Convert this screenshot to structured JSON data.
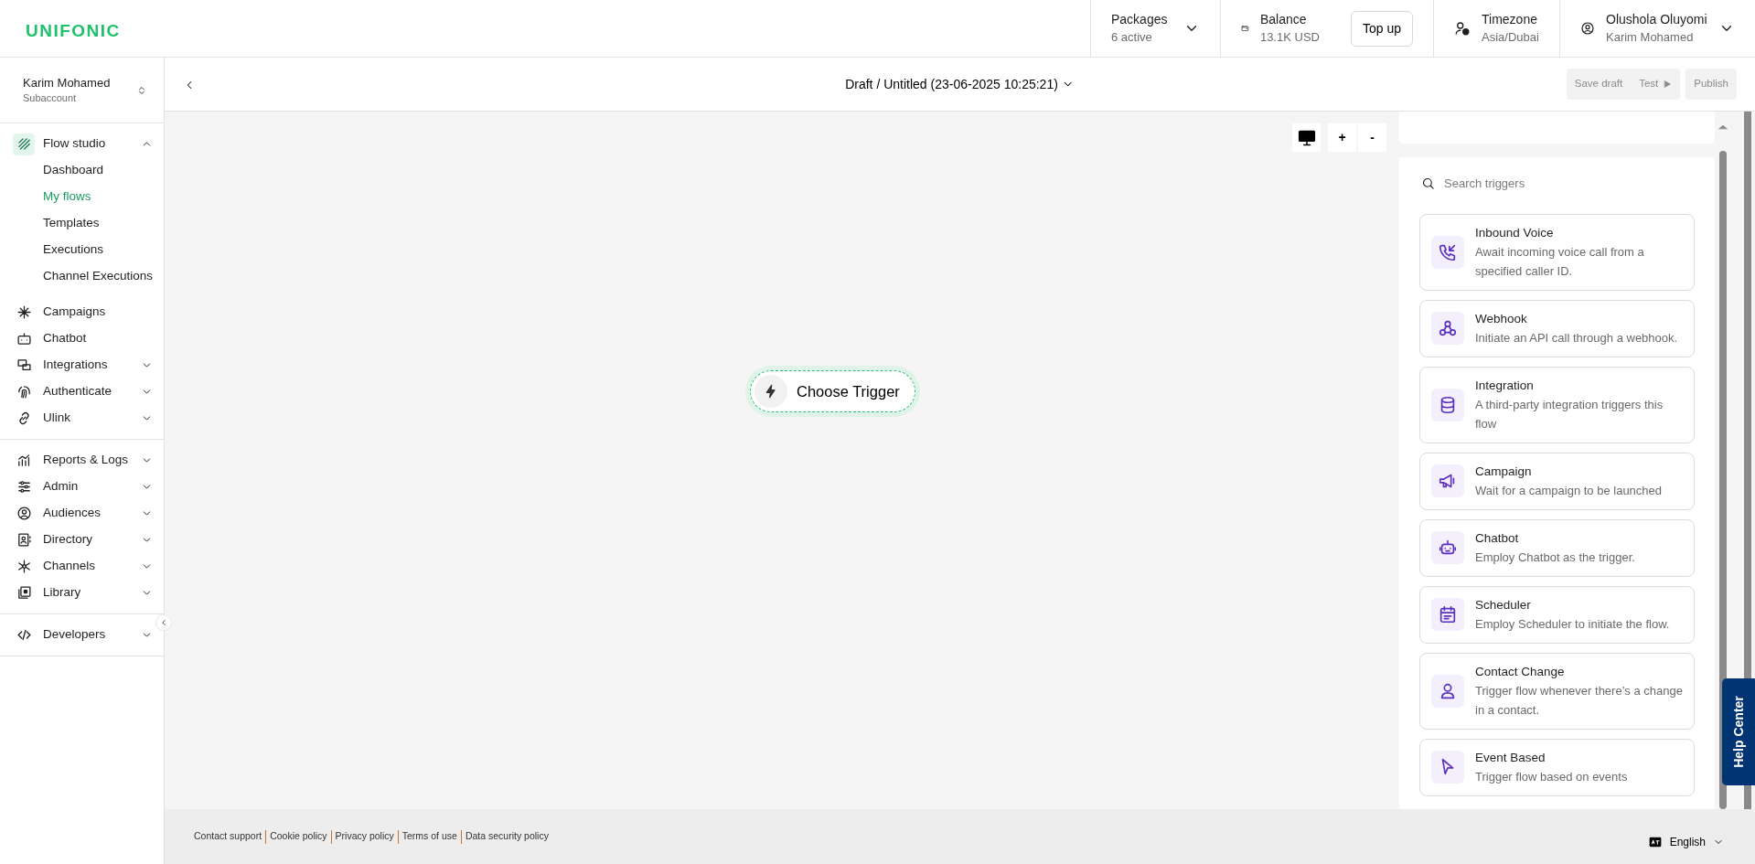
{
  "brand": "UNIFONIC",
  "header": {
    "packages": {
      "label": "Packages",
      "value": "6 active"
    },
    "balance": {
      "label": "Balance",
      "value": "13.1K USD",
      "button": "Top up"
    },
    "timezone": {
      "label": "Timezone",
      "value": "Asia/Dubai"
    },
    "user": {
      "name": "Olushola Oluyomi",
      "account": "Karim Mohamed"
    }
  },
  "account": {
    "name": "Karim Mohamed",
    "type": "Subaccount"
  },
  "sidebar": {
    "groups": [
      [
        {
          "label": "Flow studio",
          "selected": true,
          "expanded": true,
          "children": [
            {
              "label": "Dashboard",
              "selected": false
            },
            {
              "label": "My flows",
              "selected": true
            },
            {
              "label": "Templates",
              "selected": false
            },
            {
              "label": "Executions",
              "selected": false
            },
            {
              "label": "Channel Executions",
              "selected": false
            }
          ]
        },
        {
          "label": "Campaigns",
          "selected": false
        },
        {
          "label": "Chatbot",
          "selected": false
        },
        {
          "label": "Integrations",
          "selected": false,
          "expanded": false
        },
        {
          "label": "Authenticate",
          "selected": false,
          "expanded": false
        },
        {
          "label": "Ulink",
          "selected": false,
          "expanded": false
        }
      ],
      [
        {
          "label": "Reports & Logs",
          "selected": false,
          "expanded": false
        },
        {
          "label": "Admin",
          "selected": false,
          "expanded": false
        },
        {
          "label": "Audiences",
          "selected": false,
          "expanded": false
        },
        {
          "label": "Directory",
          "selected": false,
          "expanded": false
        },
        {
          "label": "Channels",
          "selected": false,
          "expanded": false
        },
        {
          "label": "Library",
          "selected": false,
          "expanded": false
        }
      ],
      [
        {
          "label": "Developers",
          "selected": false,
          "expanded": false
        }
      ]
    ]
  },
  "editor": {
    "title": "Draft / Untitled (23-06-2025 10:25:21)",
    "actions": [
      {
        "label": "Save draft",
        "disabled": true
      },
      {
        "label": "Test",
        "disabled": true
      },
      {
        "label": "Publish",
        "disabled": true
      }
    ]
  },
  "canvas": {
    "zoom_in": "+",
    "zoom_out": "-",
    "node": "Choose Trigger"
  },
  "triggers": {
    "placeholder": "Search triggers",
    "items": [
      {
        "title": "Inbound Voice",
        "description": "Await incoming voice call from a specified caller ID."
      },
      {
        "title": "Webhook",
        "description": "Initiate an API call through a webhook."
      },
      {
        "title": "Integration",
        "description": "A third-party integration triggers this flow"
      },
      {
        "title": "Campaign",
        "description": "Wait for a campaign to be launched"
      },
      {
        "title": "Chatbot",
        "description": "Employ Chatbot as the trigger."
      },
      {
        "title": "Scheduler",
        "description": "Employ Scheduler to initiate the flow."
      },
      {
        "title": "Contact Change",
        "description": "Trigger flow whenever there’s a change in a contact."
      },
      {
        "title": "Event Based",
        "description": "Trigger flow based on events"
      }
    ]
  },
  "footer": {
    "links": [
      "Contact support",
      "Cookie policy",
      "Privacy policy",
      "Terms of use",
      "Data security policy"
    ],
    "language": "English"
  },
  "help": "Help Center"
}
